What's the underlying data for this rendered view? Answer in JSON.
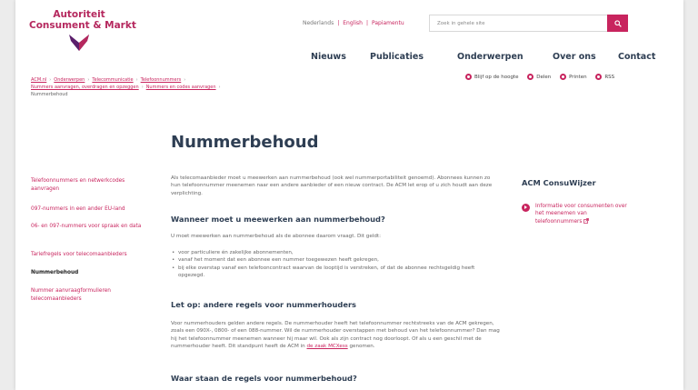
{
  "logo": {
    "line1": "Autoriteit",
    "line2": "Consument & Markt"
  },
  "languages": {
    "nl": "Nederlands",
    "en": "English",
    "pap": "Papiamentu"
  },
  "search": {
    "placeholder": "Zoek in gehele site"
  },
  "nav": [
    "Nieuws",
    "Publicaties",
    "Onderwerpen",
    "Over ons",
    "Contact"
  ],
  "breadcrumb": {
    "items": [
      "ACM.nl",
      "Onderwerpen",
      "Telecommunicatie",
      "Telefoonnummers",
      "Nummers aanvragen, overdragen en opzeggen",
      "Nummers en codes aanvragen"
    ],
    "current": "Nummerbehoud"
  },
  "share": {
    "follow": "Blijf op de hoogte",
    "share": "Delen",
    "print": "Printen",
    "rss": "RSS"
  },
  "page_title": "Nummerbehoud",
  "sidebar": [
    {
      "label": "Telefoonnummers en netwerkcodes aanvragen"
    },
    {
      "label": "097-nummers in een ander EU-land"
    },
    {
      "label": "06- en 097-nummers voor spraak en data"
    },
    {
      "label": "Tariefregels voor telecomaanbieders"
    },
    {
      "label": "Nummerbehoud"
    },
    {
      "label": "Nummer aanvraagformulieren telecomaanbieders"
    }
  ],
  "content": {
    "intro": "Als telecomaanbieder moet u meewerken aan nummerbehoud (ook wel nummerportabiliteit genoemd). Abonnees kunnen zo hun telefoonnummer meenemen naar een andere aanbieder of een nieuw contract. De ACM let erop of u zich houdt aan deze verplichting.",
    "h2_1": "Wanneer moet u meewerken aan nummerbehoud?",
    "p1": "U moet meewerken aan nummerbehoud als de abonnee daarom vraagt. Dit geldt:",
    "bullets": [
      "voor particuliere én zakelijke abonnementen,",
      "vanaf het moment dat een abonnee een nummer toegewezen heeft gekregen,",
      "bij elke overstap vanaf een telefooncontract waarvan de looptijd is verstreken, of dat de abonnee rechtsgeldig heeft opgezegd."
    ],
    "h2_2": "Let op: andere regels voor nummerhouders",
    "p2": "Voor nummerhouders gelden andere regels. De nummerhouder heeft het telefoonnummer rechtstreeks van de ACM gekregen, zoals een 090X-, 0800- of een 088-nummer. Wil de nummerhouder overstappen met behoud van het telefoonnummer? Dan mag hij het telefoonnummer meenemen wanneer hij maar wil. Ook als zijn contract nog doorloopt. Of als u een geschil met de nummerhouder heeft. Dit standpunt heeft de ACM in",
    "p2_link": "de zaak MCXess",
    "p2_end": "genomen.",
    "h2_3": "Waar staan de regels voor nummerbehoud?"
  },
  "aside": {
    "title": "ACM ConsuWijzer",
    "link": "Informatie voor consumenten over het meenemen van telefoonnummers"
  },
  "colors": {
    "accent": "#c8245e",
    "heading": "#2e3e53"
  },
  "icons": [
    "logo-mark-icon",
    "search-icon",
    "bell-icon",
    "share-icon",
    "print-icon",
    "rss-icon",
    "arrow-right-icon",
    "external-link-icon"
  ]
}
